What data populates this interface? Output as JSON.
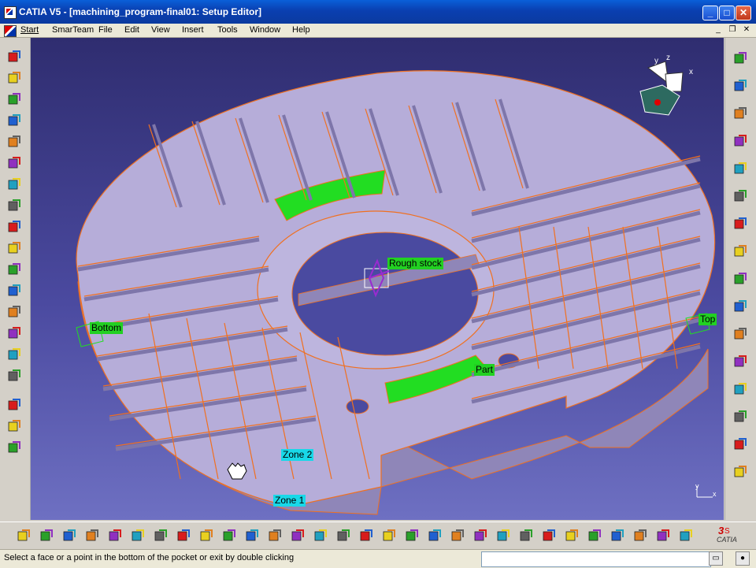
{
  "window": {
    "title": "CATIA V5 - [machining_program-final01: Setup Editor]",
    "controls": {
      "minimize": "_",
      "maximize": "□",
      "close": "✕"
    }
  },
  "menu": {
    "items": [
      "Start",
      "SmarTeam",
      "File",
      "Edit",
      "View",
      "Insert",
      "Tools",
      "Window",
      "Help"
    ],
    "mdi_controls": [
      "_",
      "❐",
      "✕"
    ]
  },
  "viewport": {
    "labels": {
      "rough_stock": "Rough stock",
      "bottom": "Bottom",
      "top": "Top",
      "part": "Part",
      "zone2": "Zone 2",
      "zone1": "Zone 1"
    },
    "compass_axes": {
      "x": "x",
      "y": "y",
      "z": "z"
    },
    "corner_axes": {
      "x": "x",
      "y": "y"
    },
    "colors": {
      "background_top": "#2f2d70",
      "background_bottom": "#6e70c2",
      "part_face": "#b4abd6",
      "edges": "#f07020",
      "selected_face": "#22dd22"
    }
  },
  "left_toolbar": {
    "icons": [
      "machining-setup-icon",
      "part-operation-icon",
      "manufacturing-program-icon",
      "machining-process-icon",
      "pocketing-icon",
      "facing-icon",
      "profile-contouring-icon",
      "curve-following-icon",
      "point-to-point-icon",
      "drilling-icon",
      "spot-drilling-icon",
      "tool-change-icon",
      "machine-rotation-icon",
      "ruled-surface-icon",
      "cutter-icon",
      "stock-icon",
      "geometry-icon",
      "feature-icon",
      "video-icon"
    ]
  },
  "right_toolbar": {
    "icons": [
      "compass-icon",
      "fly-mode-icon",
      "select-arrow-icon",
      "tool-path-replay-icon",
      "generate-nc-icon",
      "part-material-icon",
      "cube-icon",
      "rotate-icon",
      "grid-icon",
      "constraint-icon",
      "align-icon",
      "measure-icon",
      "scan-icon",
      "doc-icon",
      "export-icon",
      "photo-icon"
    ]
  },
  "bottom_toolbar": {
    "icons": [
      "new-icon",
      "open-icon",
      "save-icon",
      "print-icon",
      "cut-icon",
      "copy-icon",
      "paste-icon",
      "undo-icon",
      "redo-icon",
      "whats-this-icon",
      "fly-icon",
      "fit-all-icon",
      "pan-icon",
      "rotate-view-icon",
      "zoom-in-icon",
      "zoom-out-icon",
      "normal-view-icon",
      "iso-view-icon",
      "shading-icon",
      "hide-show-icon",
      "swap-visible-icon",
      "ruler-icon",
      "property-icon",
      "clock-icon",
      "grid-icon",
      "apply-material-icon",
      "refresh-icon",
      "analysis-icon",
      "table-icon",
      "nc-output-icon"
    ],
    "catia_logo": "CATIA"
  },
  "status": {
    "message": "Select a face or a point in the bottom of the pocket or exit by double clicking",
    "command_value": ""
  }
}
